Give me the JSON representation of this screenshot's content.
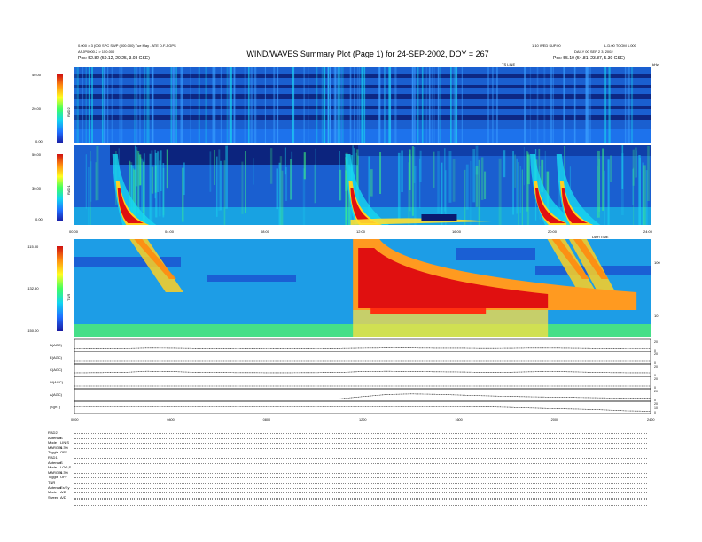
{
  "header": {
    "title": "WIND/WAVES Summary Plot (Page 1) for 24-SEP-2002, DOY = 267",
    "left_line1": "0.000 > 3 (000 SPC SWP (000.000) Tue May - ATE D.F.J GPS",
    "left_line2": "ASJP0000.2 > 150.000",
    "left_line3": "Pos: 52.82 (59.12, 20.25, 3.03 GSE)",
    "center_right": "1.10 WED SUP.00",
    "right_line1": "L.D.00 TOOM 1.000",
    "right_line2": "DAILY 00 SEP 2 3, 2002",
    "right_line3": "Pos: 55.10 (54.81, 23.87, 5.30 GSE)",
    "sub_label": "TS LINE",
    "units": "kHz"
  },
  "chart_data": [
    {
      "type": "heatmap",
      "name": "RAD2",
      "colorbar_ticks": [
        "40.00",
        "20.00",
        "0.00"
      ],
      "x_range": [
        0,
        24
      ],
      "y_units": "kHz"
    },
    {
      "type": "heatmap",
      "name": "RAD1",
      "colorbar_ticks": [
        "50.00",
        "30.00",
        "0.00"
      ],
      "x_range": [
        0,
        24
      ],
      "x_ticks": [
        "00:00",
        "04:00",
        "08:00",
        "12:00",
        "16:00",
        "20:00",
        "24:00"
      ],
      "bursts": [
        {
          "start": 1.8,
          "peak": 2.3
        },
        {
          "start": 11.5,
          "peak": 12.0
        },
        {
          "start": 19.2,
          "peak": 19.9
        },
        {
          "start": 20.3,
          "peak": 20.8
        }
      ]
    },
    {
      "type": "heatmap",
      "name": "TNR",
      "colorbar_ticks": [
        "-115.00",
        "-132.50",
        "-150.00"
      ],
      "right_ticks": [
        "100",
        "10"
      ],
      "x_range": [
        0,
        24
      ],
      "x_axis_label": "DAY/TIME"
    },
    {
      "type": "line",
      "x_range": [
        0,
        24
      ],
      "x_ticks": [
        "0000",
        "0400",
        "0800",
        "1200",
        "1600",
        "2000",
        "2400"
      ],
      "series": [
        {
          "name": "B(AGC)",
          "right_ticks": [
            "20",
            "0"
          ],
          "values": [
            1.5,
            1.6,
            1.5,
            2.2,
            2.1,
            1.7,
            1.7,
            1.6,
            1.5,
            1.6,
            1.6,
            1.7,
            2.1,
            2.3,
            2.3,
            2.1,
            2.1,
            1.8,
            1.9,
            2.2,
            2.2,
            1.9,
            1.6,
            1.5,
            1.5
          ]
        },
        {
          "name": "E(AGC)",
          "right_ticks": [
            "20",
            "0"
          ],
          "values": [
            1.0,
            1.0,
            1.0,
            1.0,
            1.0,
            1.0,
            1.0,
            1.0,
            1.0,
            1.0,
            1.0,
            1.0,
            1.0,
            1.0,
            1.0,
            1.0,
            1.0,
            1.0,
            1.0,
            1.0,
            1.0,
            1.0,
            1.0,
            1.0,
            1.0
          ]
        },
        {
          "name": "C(AGC)",
          "right_ticks": [
            "20",
            "0"
          ],
          "values": [
            2.0,
            2.2,
            2.4,
            3.8,
            3.5,
            2.6,
            2.3,
            2.2,
            2.1,
            2.1,
            2.2,
            2.4,
            3.5,
            3.8,
            3.6,
            3.2,
            3.0,
            2.6,
            2.6,
            3.2,
            3.5,
            3.0,
            2.3,
            2.1,
            2.0
          ]
        },
        {
          "name": "W(AGC)",
          "right_ticks": [
            "20",
            "0"
          ],
          "values": [
            1.0,
            1.0,
            1.0,
            1.0,
            1.0,
            1.0,
            1.0,
            1.0,
            1.0,
            1.0,
            1.0,
            1.0,
            1.0,
            1.0,
            1.0,
            1.0,
            1.0,
            1.0,
            1.0,
            1.0,
            1.0,
            1.0,
            1.0,
            1.0,
            1.0
          ]
        },
        {
          "name": "A(AGC)",
          "right_ticks": [
            "20",
            "0"
          ],
          "values": [
            0.5,
            0.5,
            0.5,
            0.5,
            0.5,
            0.5,
            0.5,
            0.5,
            0.5,
            0.5,
            0.5,
            0.6,
            3.2,
            5.5,
            6.2,
            5.8,
            5.0,
            4.2,
            3.5,
            3.0,
            2.6,
            2.2,
            1.8,
            1.5,
            1.4
          ]
        },
        {
          "name": "|B|(nT)",
          "right_ticks": [
            "20",
            "10",
            "0"
          ],
          "values": [
            5.8,
            5.8,
            5.8,
            5.8,
            5.8,
            5.8,
            5.8,
            5.8,
            5.8,
            5.8,
            5.8,
            5.8,
            5.8,
            5.8,
            5.8,
            5.8,
            5.8,
            5.6,
            5.0,
            4.2,
            3.5,
            3.0,
            2.2,
            1.0,
            0.6
          ]
        }
      ]
    }
  ],
  "footer": {
    "blocks": [
      {
        "rows": [
          [
            "RAD2",
            ""
          ],
          [
            "Antenna",
            "S"
          ],
          [
            "Mode",
            "LIN S"
          ],
          [
            "MARGIN",
            "0.3%"
          ],
          [
            "Toggle",
            "OFF"
          ]
        ]
      },
      {
        "rows": [
          [
            "RAD1",
            ""
          ],
          [
            "Antenna",
            "S"
          ],
          [
            "Mode",
            "LOG,S"
          ],
          [
            "MARGIN",
            "0.3%"
          ],
          [
            "Toggle",
            "OFF"
          ]
        ]
      },
      {
        "rows": [
          [
            "TNR",
            ""
          ],
          [
            "Antenna",
            "Ex/Ey"
          ],
          [
            "Mode",
            "A/D"
          ],
          [
            "Sweep",
            "A/D"
          ]
        ]
      }
    ]
  },
  "colors": {
    "background": "#1a5fd0",
    "dark": "#0a1a70",
    "burst_red": "#e01010",
    "burst_yellow": "#ffd020",
    "cyan": "#18d8f0"
  }
}
